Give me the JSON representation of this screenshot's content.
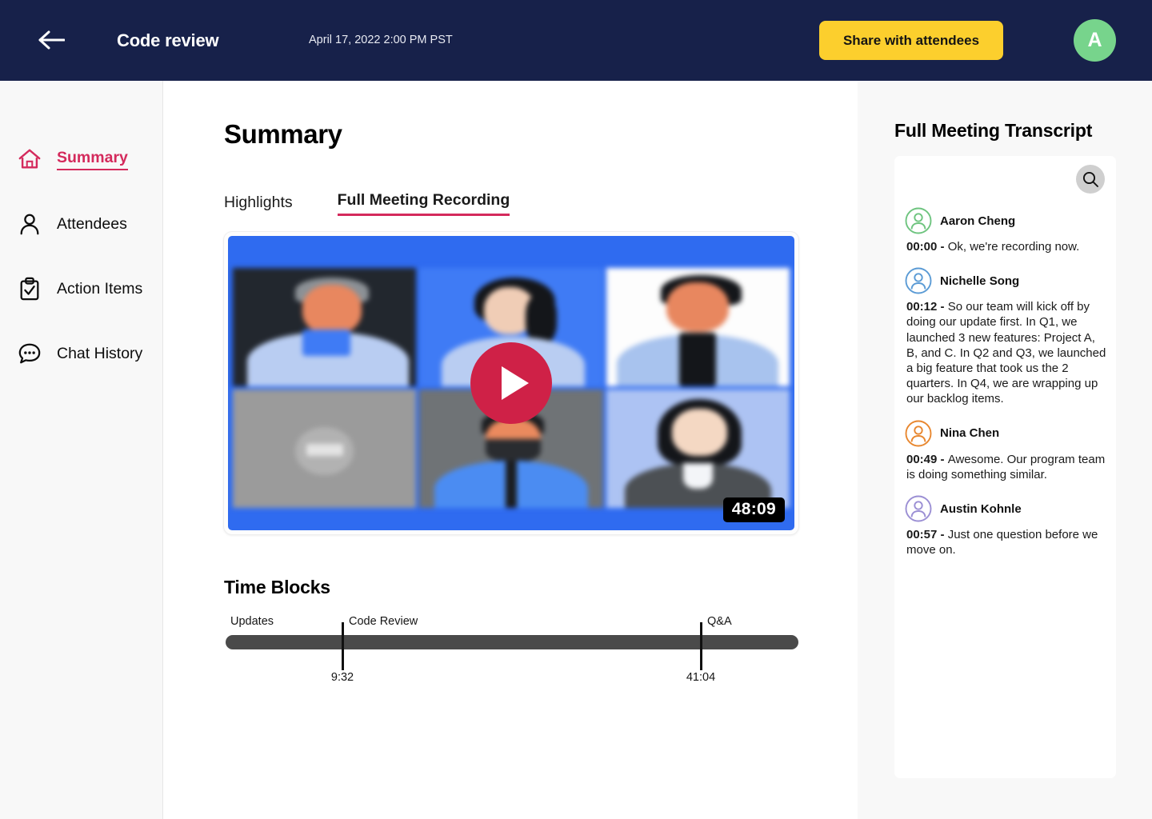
{
  "header": {
    "back_icon": "arrow-left-icon",
    "title": "Code review",
    "date": "April 17, 2022 2:00 PM PST",
    "share_label": "Share with attendees",
    "avatar_initial": "A",
    "bg_color": "#17214a",
    "share_color": "#fccf2d",
    "avatar_color": "#77d48c"
  },
  "sidebar": {
    "items": [
      {
        "label": "Summary",
        "icon": "home-icon",
        "active": true
      },
      {
        "label": "Attendees",
        "icon": "person-icon",
        "active": false
      },
      {
        "label": "Action Items",
        "icon": "clipboard-check-icon",
        "active": false
      },
      {
        "label": "Chat History",
        "icon": "chat-bubble-icon",
        "active": false
      }
    ],
    "active_color": "#d42a5c"
  },
  "main": {
    "page_title": "Summary",
    "tabs": [
      {
        "label": "Highlights",
        "active": false
      },
      {
        "label": "Full Meeting Recording",
        "active": true
      }
    ],
    "video": {
      "duration": "48:09",
      "play_icon": "play-icon",
      "play_color": "#cf2147"
    },
    "time_blocks": {
      "title": "Time Blocks",
      "bar_color": "#4a4a4a",
      "blocks": [
        {
          "label": "Updates",
          "time": "",
          "position_pct": 0
        },
        {
          "label": "Code Review",
          "time": "9:32",
          "position_pct": 20.5
        },
        {
          "label": "Q&A",
          "time": "41:04",
          "position_pct": 83.0
        }
      ]
    }
  },
  "transcript": {
    "title": "Full Meeting Transcript",
    "search_icon": "search-icon",
    "entries": [
      {
        "speaker": "Aaron Cheng",
        "avatar_color": "#6ec47f",
        "time": "00:00",
        "text": "Ok, we're recording now."
      },
      {
        "speaker": "Nichelle Song",
        "avatar_color": "#5b9bd5",
        "time": "00:12",
        "text": "So our team will kick off by doing our update first. In Q1, we launched 3 new features: Project A, B, and C. In Q2 and Q3, we launched a big feature that took us the 2 quarters. In Q4, we are wrapping up our backlog items."
      },
      {
        "speaker": "Nina Chen",
        "avatar_color": "#e8872f",
        "time": "00:49",
        "text": "Awesome. Our program team is doing something similar."
      },
      {
        "speaker": "Austin Kohnle",
        "avatar_color": "#9b8fd4",
        "time": "00:57",
        "text": "Just one question before we move on."
      }
    ]
  }
}
